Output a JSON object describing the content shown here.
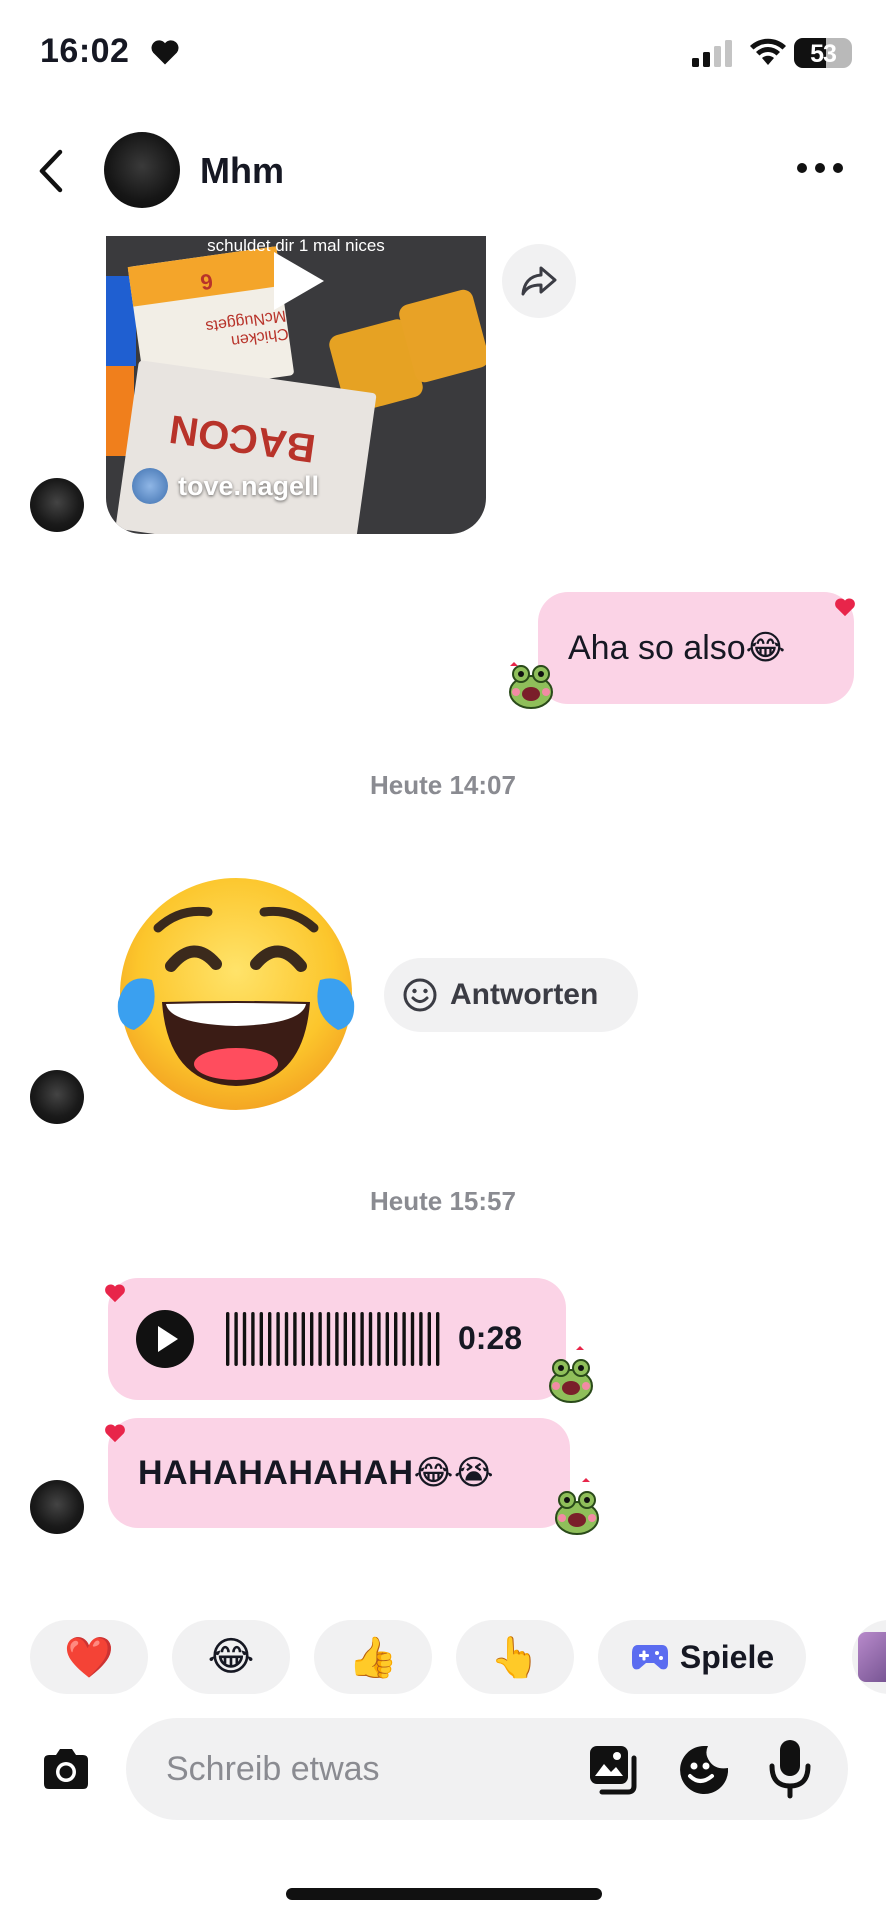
{
  "status_bar": {
    "time": "16:02",
    "battery": "53",
    "icons": [
      "heart-icon",
      "cellular-signal-icon",
      "wifi-icon",
      "battery-icon"
    ]
  },
  "header": {
    "contact_name": "Mhm",
    "icons": [
      "back-icon",
      "more-options-icon"
    ]
  },
  "messages": {
    "video_share": {
      "caption": "schuldet dir 1 mal nices",
      "username": "tove.nagell",
      "box_text_1": "Chicken McNuggets",
      "box_text_2": "BACON",
      "nugget_count": "6"
    },
    "sent_text": "Aha so also😂",
    "timestamp_1": "Heute 14:07",
    "big_emoji": "😂",
    "reply_label": "Antworten",
    "timestamp_2": "Heute 15:57",
    "voice_duration": "0:28",
    "received_text": "HAHAHAHAHAH😂😭"
  },
  "quick_reactions": {
    "items": [
      "❤️",
      "😂",
      "👍",
      "👆"
    ],
    "games_label": "Spiele"
  },
  "composer": {
    "placeholder": "Schreib etwas",
    "icons": [
      "camera-icon",
      "gallery-icon",
      "sticker-icon",
      "microphone-icon"
    ]
  },
  "colors": {
    "bubble_pink": "#fbd3e6",
    "chip_gray": "#f1f1f2",
    "heart_red": "#e8254a",
    "games_blue": "#5b6cf0"
  }
}
